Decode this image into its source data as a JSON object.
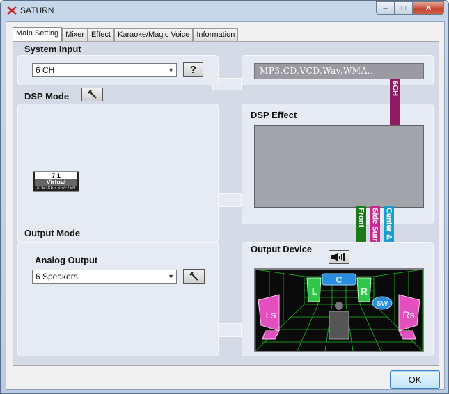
{
  "window": {
    "title": "SATURN",
    "minimize": "–",
    "maximize": "□",
    "close": "✕"
  },
  "tabs": [
    {
      "label": "Main Setting",
      "active": true
    },
    {
      "label": "Mixer"
    },
    {
      "label": "Effect"
    },
    {
      "label": "Karaoke/Magic Voice"
    },
    {
      "label": "Information"
    }
  ],
  "system_input": {
    "label": "System Input",
    "selected": "6 CH",
    "help_label": "?",
    "formats": "MP3,CD,VCD,Wav,WMA.."
  },
  "dsp_mode": {
    "label": "DSP Mode",
    "badge_top": "7.1",
    "badge_mid": "Virtual",
    "badge_bot": "SPEAKER SHIFTER"
  },
  "dsp_effect": {
    "label": "DSP Effect"
  },
  "channels": {
    "six_ch": "6CH",
    "front": "Front",
    "side_surround": "Side Surround",
    "center_sub": "Center & Sub"
  },
  "output_mode": {
    "label": "Output Mode",
    "analog_label": "Analog Output",
    "selected": "6 Speakers"
  },
  "output_device": {
    "label": "Output Device",
    "speakers": {
      "left": "L",
      "center": "C",
      "right": "R",
      "subwoofer": "SW",
      "left_surround": "Ls",
      "right_surround": "Rs"
    }
  },
  "ok_label": "OK",
  "colors": {
    "six_ch": "#8d1a63",
    "front": "#1a7a1a",
    "side_surround": "#c8288f",
    "center_sub": "#1aa0c8",
    "room_green": "#1fd41f",
    "surround_pink": "#e44fc0",
    "front_green": "#2fc64a",
    "center_blue": "#2a8ee0"
  }
}
